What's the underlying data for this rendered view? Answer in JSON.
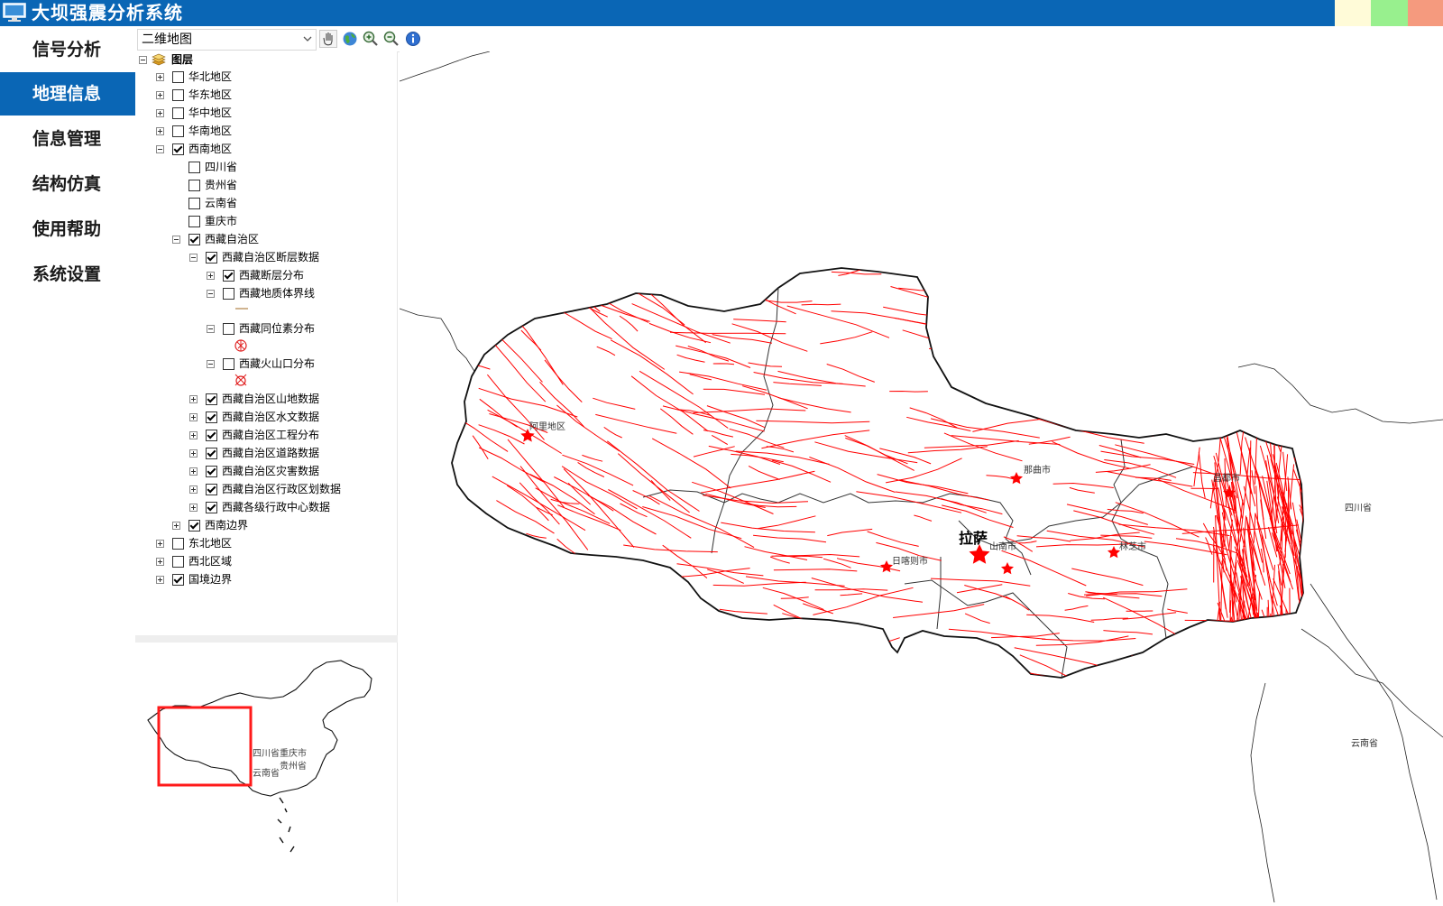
{
  "app": {
    "title": "大坝强震分析系统",
    "swatch_colors": [
      "#fffbd8",
      "#98f08e",
      "#f59a7e"
    ]
  },
  "sidebar": {
    "items": [
      {
        "label": "信号分析",
        "active": false
      },
      {
        "label": "地理信息",
        "active": true
      },
      {
        "label": "信息管理",
        "active": false
      },
      {
        "label": "结构仿真",
        "active": false
      },
      {
        "label": "使用帮助",
        "active": false
      },
      {
        "label": "系统设置",
        "active": false
      }
    ]
  },
  "toolbar": {
    "map_mode": "二维地图",
    "tools": [
      "pan-hand-icon",
      "globe-icon",
      "zoom-in-icon",
      "zoom-out-icon",
      "info-icon"
    ]
  },
  "layers": {
    "root": "图层",
    "huabei": "华北地区",
    "huadong": "华东地区",
    "huazhong": "华中地区",
    "huanan": "华南地区",
    "xinan": "西南地区",
    "sichuan": "四川省",
    "guizhou": "贵州省",
    "yunnan": "云南省",
    "chongqing": "重庆市",
    "xizang": "西藏自治区",
    "fault_data": "西藏自治区断层数据",
    "fault_dist": "西藏断层分布",
    "geo_boundary": "西藏地质体界线",
    "isotope": "西藏同位素分布",
    "volcano": "西藏火山口分布",
    "mountain": "西藏自治区山地数据",
    "hydro": "西藏自治区水文数据",
    "engineering": "西藏自治区工程分布",
    "road": "西藏自治区道路数据",
    "disaster": "西藏自治区灾害数据",
    "admin": "西藏自治区行政区划数据",
    "centers": "西藏各级行政中心数据",
    "xinan_border": "西南边界",
    "dongbei": "东北地区",
    "xibei": "西北区域",
    "national_border": "国境边界"
  },
  "map": {
    "labels": {
      "ali": "阿里地区",
      "naqu": "那曲市",
      "changdu": "昌都市",
      "lhasa": "拉萨",
      "shannan": "山南市",
      "shigatse": "日喀则市",
      "nyingchi": "林芝市",
      "sichuan": "四川省",
      "yunnan": "云南省"
    },
    "fault_color": "#ff0000",
    "boundary_color": "#000000"
  },
  "overview": {
    "labels": {
      "sichuan_chongqing": "四川省重庆市",
      "guizhou": "贵州省",
      "yunnan": "云南省"
    },
    "extent_color": "#ff0000"
  }
}
